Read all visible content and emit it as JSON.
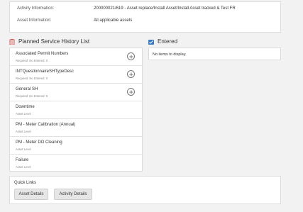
{
  "info": {
    "activity_label": "Activity Information:",
    "activity_value": "200000021/619 - Asset replace/Install Asset/Install Asset tracked & Test FR",
    "asset_label": "Asset Information:",
    "asset_value": "All applicable assets"
  },
  "planned": {
    "title": "Planned Service History List",
    "icon": "clipboard-icon",
    "items": [
      {
        "name": "Associated Permit Numbers",
        "meta": "Required: No   Entered: 0"
      },
      {
        "name": "INTQuestionnaireSHTypeDesc",
        "meta": "Required: No   Entered: 0"
      },
      {
        "name": "General SH",
        "meta": "Required: No   Entered: 0"
      },
      {
        "name": "Downtime",
        "meta": "Asset Level"
      },
      {
        "name": "PM - Meter Calibration (Annual)",
        "meta": "Asset Level"
      },
      {
        "name": "PM - Meter DO Cleaning",
        "meta": "Asset Level"
      },
      {
        "name": "Failure",
        "meta": "Asset Level"
      }
    ]
  },
  "entered": {
    "title": "Entered",
    "icon": "check-list-icon",
    "empty_text": "No items to display."
  },
  "quick_links": {
    "title": "Quick Links",
    "asset_details": "Asset Details",
    "activity_details": "Activity Details"
  },
  "colors": {
    "icon_orange": "#d9534f",
    "icon_blue": "#3a7bc8"
  }
}
